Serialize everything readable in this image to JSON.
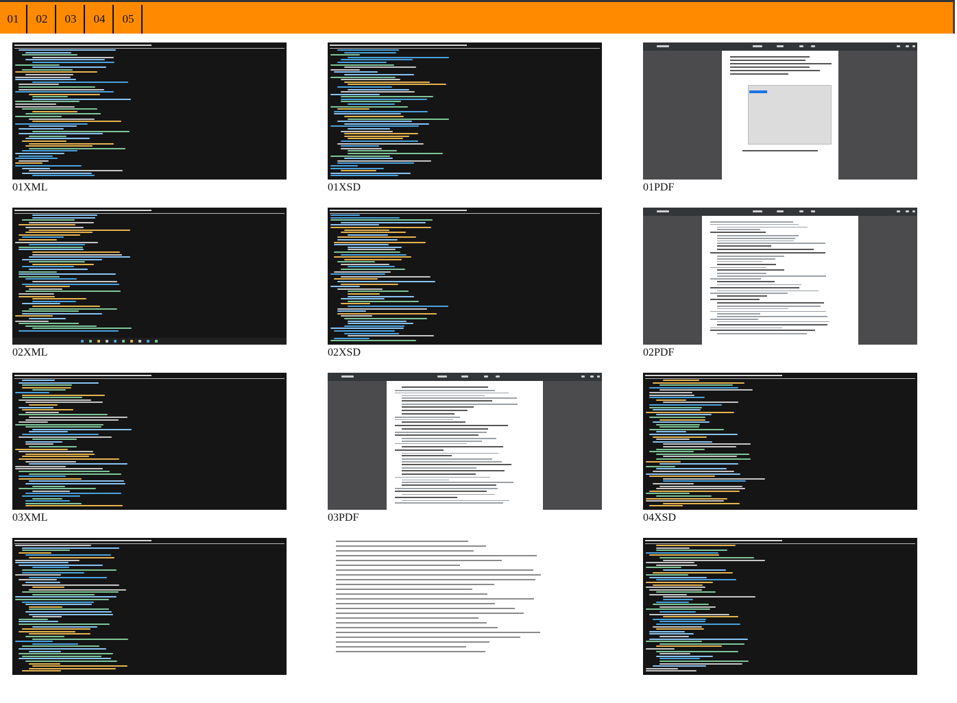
{
  "nav": {
    "tabs": [
      "01",
      "02",
      "03",
      "04",
      "05"
    ]
  },
  "colors": {
    "nav_bg": "#ff8a00",
    "viewer_dark": "#151515",
    "pdf_bg": "#4b4b4e"
  },
  "gallery": [
    {
      "caption": "01XML",
      "kind": "xml-dark",
      "icon": "xml-preview"
    },
    {
      "caption": "01XSD",
      "kind": "xsd-dark",
      "icon": "xsd-preview"
    },
    {
      "caption": "01PDF",
      "kind": "pdf",
      "icon": "pdf-preview"
    },
    {
      "caption": "02XML",
      "kind": "xml-dark-taskbar",
      "icon": "xml-preview"
    },
    {
      "caption": "02XSD",
      "kind": "xsd-dark",
      "icon": "xsd-preview"
    },
    {
      "caption": "02PDF",
      "kind": "pdf",
      "icon": "pdf-preview"
    },
    {
      "caption": "03XML",
      "kind": "xml-dark",
      "icon": "xml-preview"
    },
    {
      "caption": "03PDF",
      "kind": "pdf",
      "icon": "pdf-preview"
    },
    {
      "caption": "04XSD",
      "kind": "xsd-dark",
      "icon": "xsd-preview"
    },
    {
      "caption": "",
      "kind": "xml-dark",
      "icon": "xml-preview"
    },
    {
      "caption": "",
      "kind": "dtd-light",
      "icon": "dtd-preview"
    },
    {
      "caption": "",
      "kind": "xsd-dark",
      "icon": "xsd-preview"
    }
  ]
}
